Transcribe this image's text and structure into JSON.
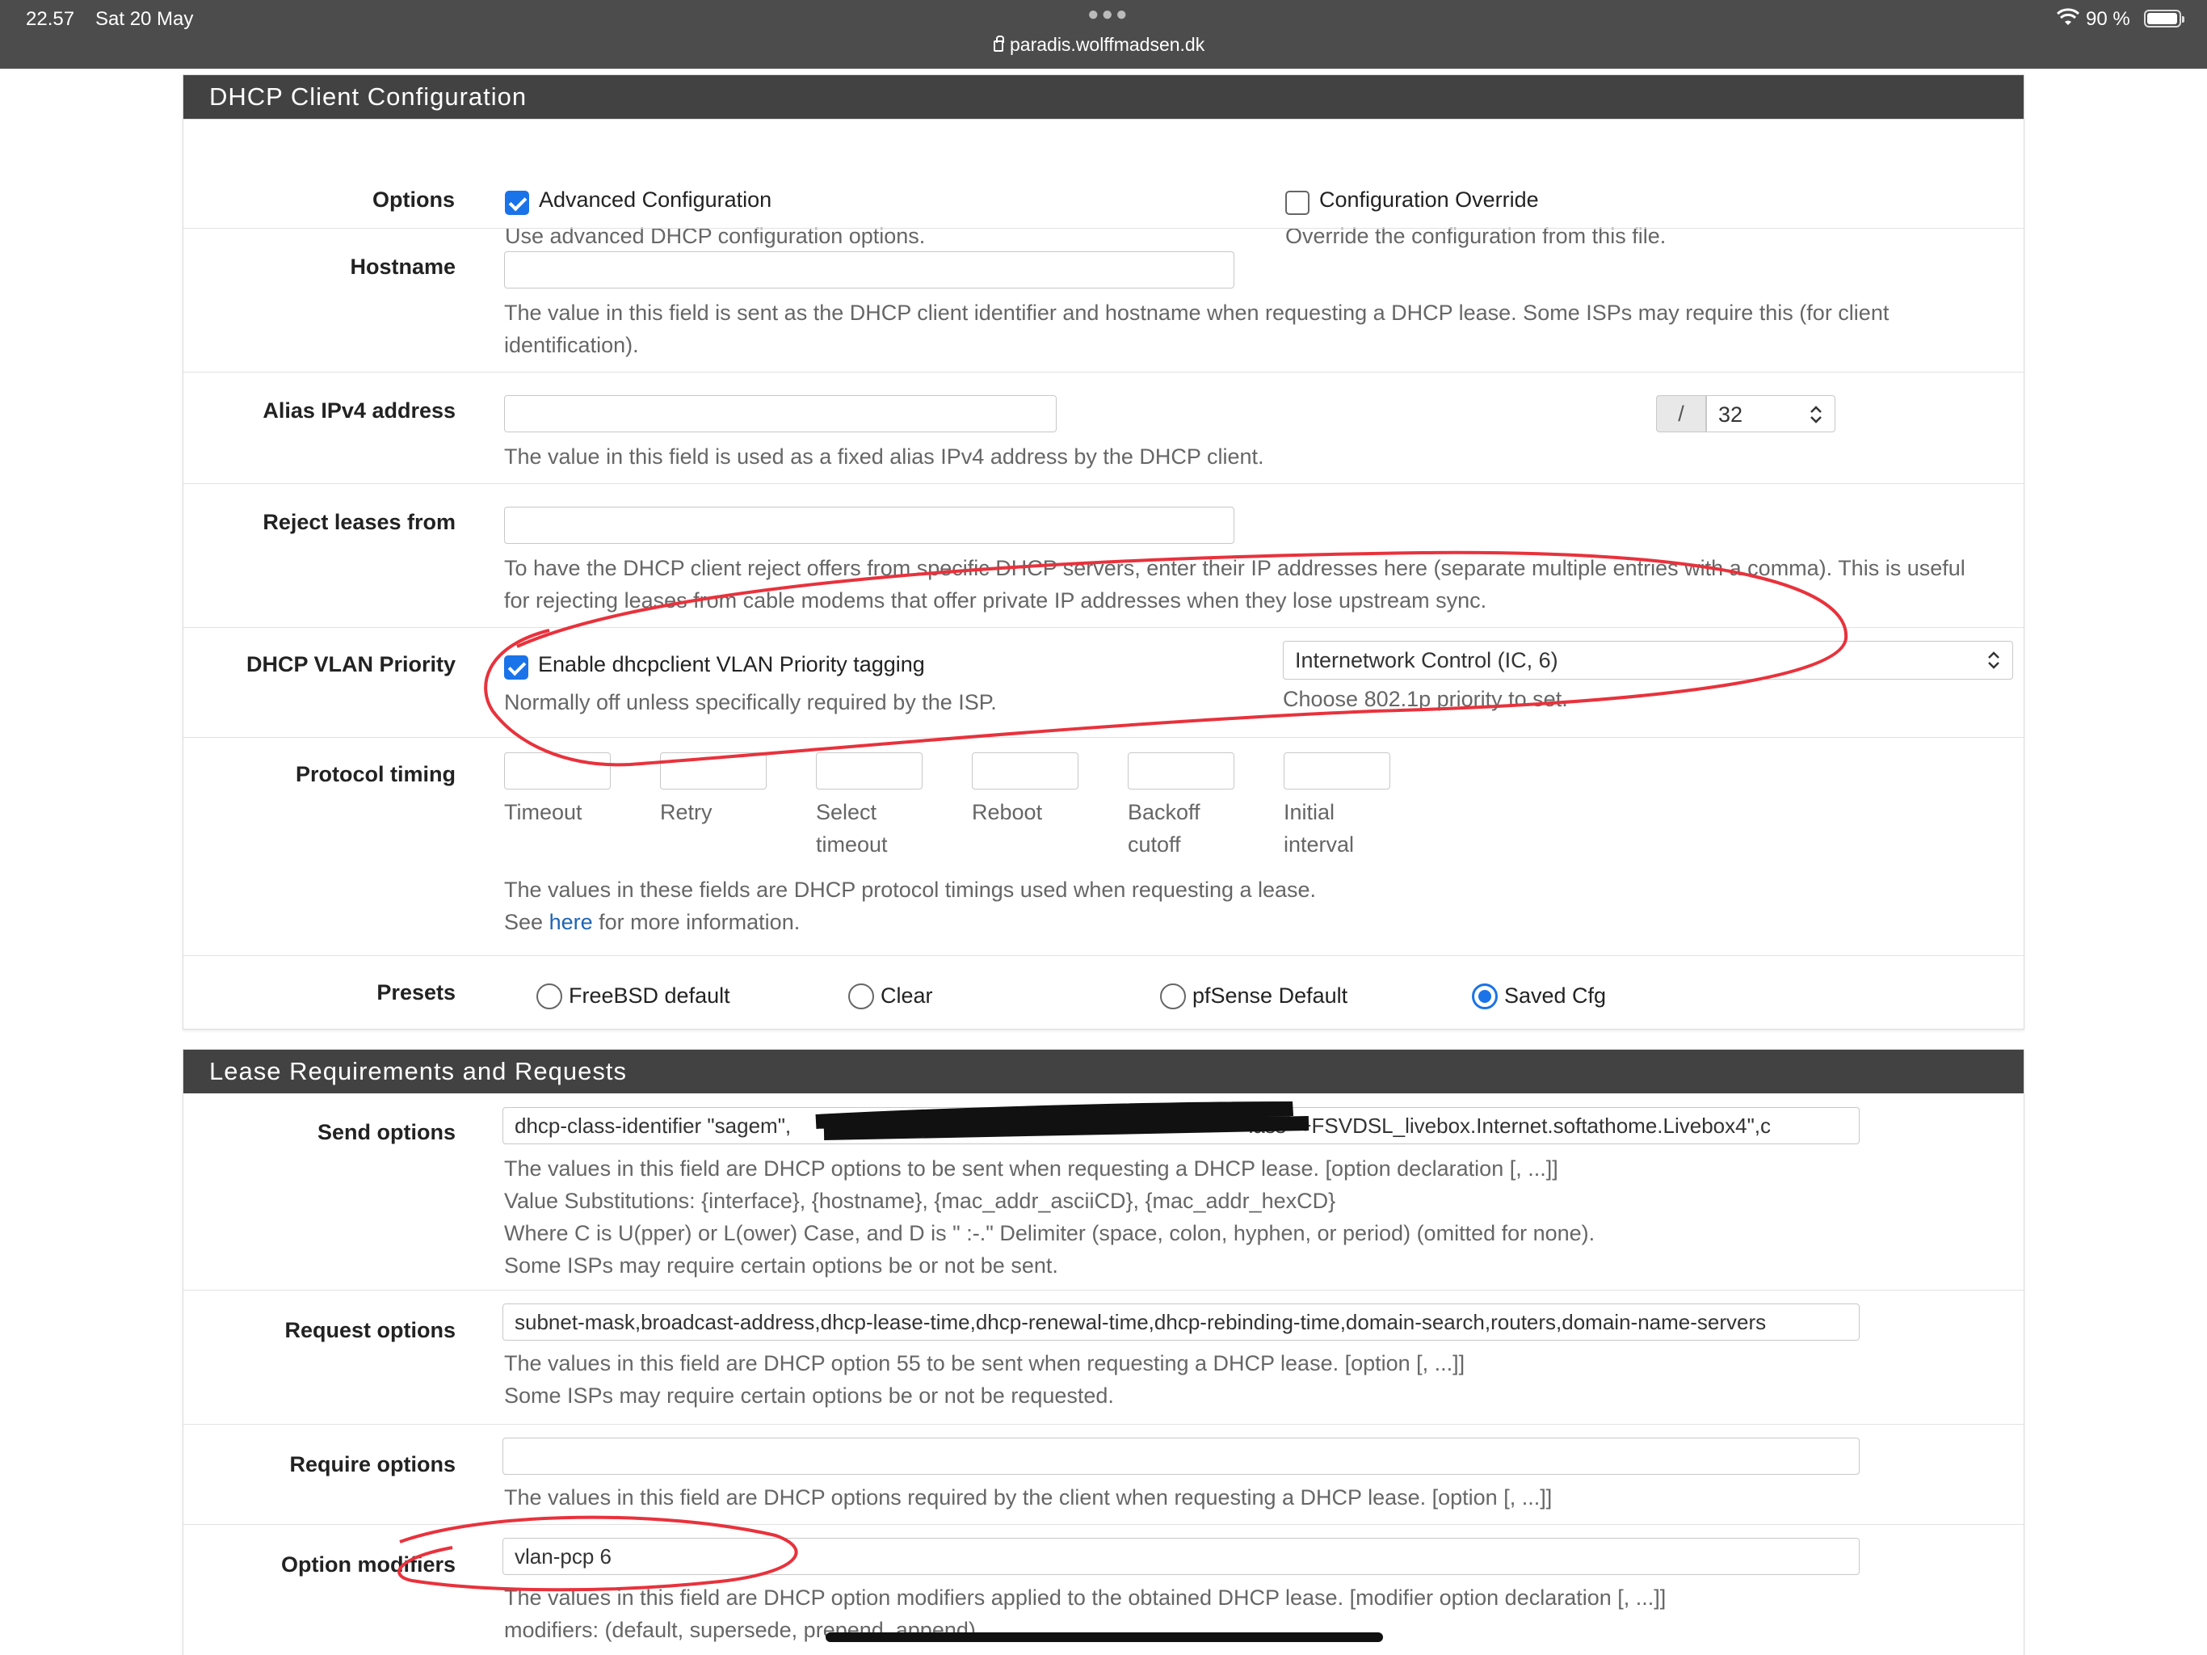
{
  "status_bar": {
    "time": "22.57",
    "date": "Sat 20 May",
    "url": "paradis.wolffmadsen.dk",
    "battery": "90 %"
  },
  "dhcp_client": {
    "title": "DHCP Client Configuration",
    "options": {
      "label": "Options",
      "advanced": {
        "label": "Advanced Configuration",
        "checked": true,
        "help": "Use advanced DHCP configuration options."
      },
      "override": {
        "label": "Configuration Override",
        "checked": false,
        "help": "Override the configuration from this file."
      }
    },
    "hostname": {
      "label": "Hostname",
      "value": "",
      "help_line1": "The value in this field is sent as the DHCP client identifier and hostname when requesting a DHCP lease. Some ISPs may require this (for client",
      "help_line2": "identification)."
    },
    "alias": {
      "label": "Alias IPv4 address",
      "value": "",
      "slash": "/",
      "cidr": "32",
      "help": "The value in this field is used as a fixed alias IPv4 address by the DHCP client."
    },
    "reject": {
      "label": "Reject leases from",
      "value": "",
      "help_line1": "To have the DHCP client reject offers from specific DHCP servers, enter their IP addresses here (separate multiple entries with a comma). This is useful",
      "help_line2": "for rejecting leases from cable modems that offer private IP addresses when they lose upstream sync."
    },
    "vlan": {
      "label": "DHCP VLAN Priority",
      "checkbox_label": "Enable dhcpclient VLAN Priority tagging",
      "checked": true,
      "help": "Normally off unless specifically required by the ISP.",
      "select_value": "Internetwork Control (IC, 6)",
      "select_help": "Choose 802.1p priority to set."
    },
    "timing": {
      "label": "Protocol timing",
      "fields": [
        {
          "line1": "Timeout",
          "line2": ""
        },
        {
          "line1": "Retry",
          "line2": ""
        },
        {
          "line1": "Select",
          "line2": "timeout"
        },
        {
          "line1": "Reboot",
          "line2": ""
        },
        {
          "line1": "Backoff",
          "line2": "cutoff"
        },
        {
          "line1": "Initial",
          "line2": "interval"
        }
      ],
      "help_line1": "The values in these fields are DHCP protocol timings used when requesting a lease.",
      "help_see": "See",
      "help_link": "here",
      "help_rest": "for more information."
    },
    "presets": {
      "label": "Presets",
      "options": [
        {
          "label": "FreeBSD default",
          "selected": false
        },
        {
          "label": "Clear",
          "selected": false
        },
        {
          "label": "pfSense Default",
          "selected": false
        },
        {
          "label": "Saved Cfg",
          "selected": true
        }
      ]
    }
  },
  "lease": {
    "title": "Lease Requirements and Requests",
    "send": {
      "label": "Send options",
      "value_start": "dhcp-class-identifier \"sagem\",",
      "value_end": "lass \"+FSVDSL_livebox.Internet.softathome.Livebox4\",c",
      "help": [
        "The values in this field are DHCP options to be sent when requesting a DHCP lease. [option declaration [, ...]]",
        "Value Substitutions: {interface}, {hostname}, {mac_addr_asciiCD}, {mac_addr_hexCD}",
        "Where C is U(pper) or L(ower) Case, and D is \" :-.\" Delimiter (space, colon, hyphen, or period) (omitted for none).",
        "Some ISPs may require certain options be or not be sent."
      ]
    },
    "request": {
      "label": "Request options",
      "value": "subnet-mask,broadcast-address,dhcp-lease-time,dhcp-renewal-time,dhcp-rebinding-time,domain-search,routers,domain-name-servers",
      "help": [
        "The values in this field are DHCP option 55 to be sent when requesting a DHCP lease. [option [, ...]]",
        "Some ISPs may require certain options be or not be requested."
      ]
    },
    "require": {
      "label": "Require options",
      "value": "",
      "help": "The values in this field are DHCP options required by the client when requesting a DHCP lease. [option [, ...]]"
    },
    "modifiers": {
      "label": "Option modifiers",
      "value": "vlan-pcp 6",
      "help_line1": "The values in this field are DHCP option modifiers applied to the obtained DHCP lease. [modifier option declaration [, ...]]",
      "help_line2": "modifiers: (default, supersede, prepend, append)"
    }
  },
  "colors": {
    "header": "#424242",
    "accent": "#1a73e8",
    "annotation": "#e8323c"
  }
}
